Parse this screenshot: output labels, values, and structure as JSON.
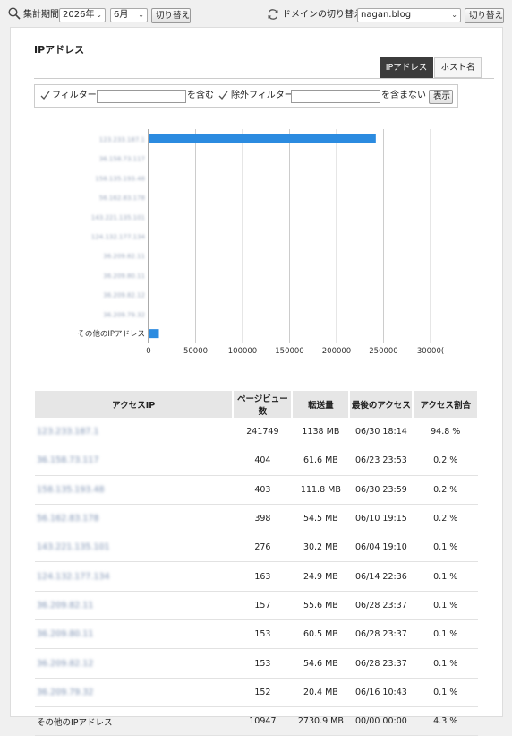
{
  "topbar": {
    "period_label": "集計期間",
    "year": "2026年",
    "month": "6月",
    "switch_button": "切り替え",
    "domain_label": "ドメインの切り替え",
    "domain": "nagan.blog",
    "domain_switch_button": "切り替え"
  },
  "section": {
    "title": "IPアドレス",
    "tab_ip": "IPアドレス",
    "tab_host": "ホスト名"
  },
  "filter": {
    "filter_label": "フィルター",
    "filter_value": "",
    "contains": "を含む",
    "exclude_label": "除外フィルター",
    "exclude_value": "",
    "not_contains": "を含まない",
    "show_button": "表示"
  },
  "chart_data": {
    "type": "bar",
    "orientation": "horizontal",
    "categories": [
      "123.233.187.1",
      "36.158.73.117",
      "158.135.193.48",
      "56.162.83.178",
      "143.221.135.101",
      "124.132.177.134",
      "36.209.82.11",
      "36.209.80.11",
      "36.209.82.12",
      "36.209.79.32",
      "その他のIPアドレス"
    ],
    "values": [
      241749,
      404,
      403,
      398,
      276,
      163,
      157,
      153,
      153,
      152,
      10947
    ],
    "xticks": [
      "0",
      "50000",
      "100000",
      "150000",
      "200000",
      "250000",
      "30000("
    ],
    "xlim": [
      0,
      300000
    ],
    "color": "#2b8be0",
    "grid": true
  },
  "table": {
    "headers": [
      "アクセスIP",
      "ページビュー数",
      "転送量",
      "最後のアクセス",
      "アクセス割合"
    ],
    "rows": [
      {
        "ip": "123.233.187.1",
        "pv": "241749",
        "size": "1138 MB",
        "last": "06/30 18:14",
        "ratio": "94.8 %"
      },
      {
        "ip": "36.158.73.117",
        "pv": "404",
        "size": "61.6 MB",
        "last": "06/23 23:53",
        "ratio": "0.2 %"
      },
      {
        "ip": "158.135.193.48",
        "pv": "403",
        "size": "111.8 MB",
        "last": "06/30 23:59",
        "ratio": "0.2 %"
      },
      {
        "ip": "56.162.83.178",
        "pv": "398",
        "size": "54.5 MB",
        "last": "06/10 19:15",
        "ratio": "0.2 %"
      },
      {
        "ip": "143.221.135.101",
        "pv": "276",
        "size": "30.2 MB",
        "last": "06/04 19:10",
        "ratio": "0.1 %"
      },
      {
        "ip": "124.132.177.134",
        "pv": "163",
        "size": "24.9 MB",
        "last": "06/14 22:36",
        "ratio": "0.1 %"
      },
      {
        "ip": "36.209.82.11",
        "pv": "157",
        "size": "55.6 MB",
        "last": "06/28 23:37",
        "ratio": "0.1 %"
      },
      {
        "ip": "36.209.80.11",
        "pv": "153",
        "size": "60.5 MB",
        "last": "06/28 23:37",
        "ratio": "0.1 %"
      },
      {
        "ip": "36.209.82.12",
        "pv": "153",
        "size": "54.6 MB",
        "last": "06/28 23:37",
        "ratio": "0.1 %"
      },
      {
        "ip": "36.209.79.32",
        "pv": "152",
        "size": "20.4 MB",
        "last": "06/16 10:43",
        "ratio": "0.1 %"
      },
      {
        "ip": "その他のIPアドレス",
        "pv": "10947",
        "size": "2730.9 MB",
        "last": "00/00 00:00",
        "ratio": "4.3 %"
      }
    ]
  },
  "icons": {
    "search": "search-icon",
    "refresh": "refresh-icon",
    "check": "check-icon"
  }
}
